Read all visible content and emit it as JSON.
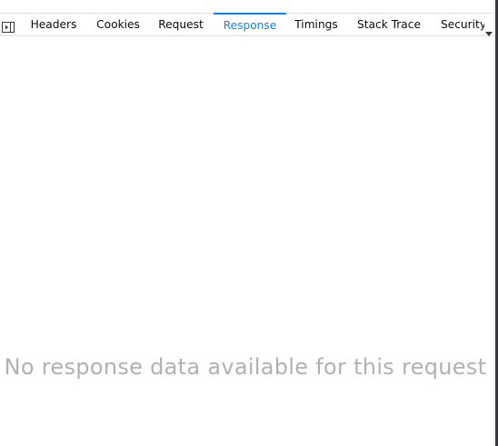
{
  "tabs": {
    "panel_toggle_icon": "sidebar-toggle-icon",
    "items": [
      {
        "label": "Headers"
      },
      {
        "label": "Cookies"
      },
      {
        "label": "Request"
      },
      {
        "label": "Response",
        "selected": true
      },
      {
        "label": "Timings"
      },
      {
        "label": "Stack Trace"
      }
    ],
    "overflow_label": "Security",
    "overflow_icon": "chevron-down-icon"
  },
  "response": {
    "empty_message": "No response data available for this request"
  },
  "colors": {
    "accent": "#0a84ff",
    "text": "#0c0c0d",
    "muted": "#b1b1b3",
    "border": "#e0e0e2"
  }
}
